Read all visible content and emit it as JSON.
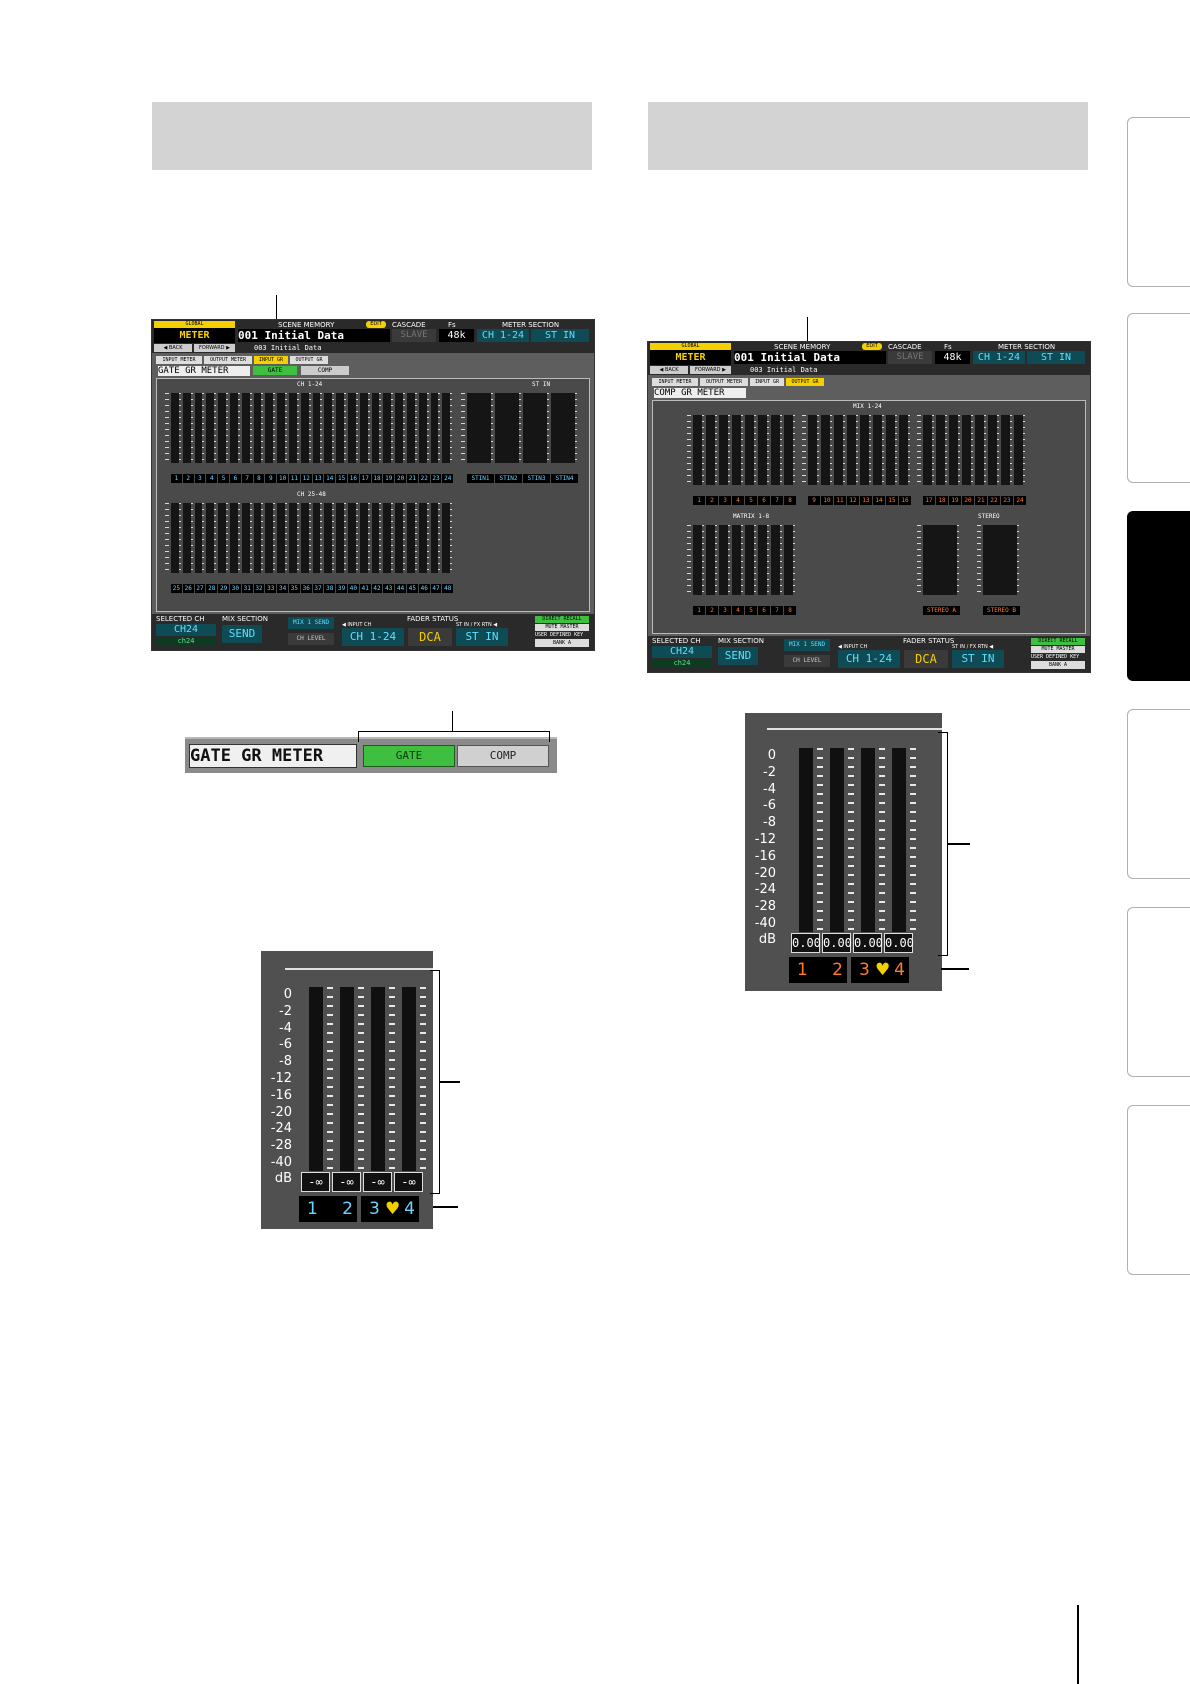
{
  "left_shot": {
    "global": "GLOBAL",
    "mode": "METER",
    "back": "◀ BACK",
    "forward": "FORWARD ▶",
    "scene_memory_label": "SCENE MEMORY",
    "edit_badge": "EDIT",
    "scene_name": "001 Initial Data",
    "last_scene": "003 Initial Data",
    "cascade_label": "CASCADE",
    "slave": "SLAVE",
    "fs_label": "Fs",
    "fs_value": "48k",
    "meter_section_label": "METER SECTION",
    "meter_ch": "CH 1-24",
    "meter_st": "ST IN",
    "tabs": [
      "INPUT METER",
      "OUTPUT METER",
      "INPUT GR",
      "OUTPUT GR"
    ],
    "page_title": "GATE GR METER",
    "gate_btn": "GATE",
    "comp_btn": "COMP",
    "group1_title": "CH 1-24",
    "group2_title": "ST IN",
    "group3_title": "CH 25-48",
    "ch_labels_row1": [
      "1",
      "2",
      "3",
      "4",
      "5",
      "6",
      "7",
      "8",
      "9",
      "10",
      "11",
      "12",
      "13",
      "14",
      "15",
      "16",
      "17",
      "18",
      "19",
      "20",
      "21",
      "22",
      "23",
      "24"
    ],
    "st_labels": [
      "STIN1",
      "STIN2",
      "STIN3",
      "STIN4"
    ],
    "ch_labels_row2": [
      "25",
      "26",
      "27",
      "28",
      "29",
      "30",
      "31",
      "32",
      "33",
      "34",
      "35",
      "36",
      "37",
      "38",
      "39",
      "40",
      "41",
      "42",
      "43",
      "44",
      "45",
      "46",
      "47",
      "48"
    ],
    "selected_ch_label": "SELECTED CH",
    "selected_ch": "CH24",
    "selected_ch_name": "ch24",
    "mix_section_label": "MIX SECTION",
    "mix_send": "SEND",
    "mix1_send": "MIX 1 SEND",
    "ch_level": "CH LEVEL",
    "fader_status_label": "FADER STATUS",
    "input_ch_label": "◀ INPUT CH",
    "fader_ch": "CH 1-24",
    "dca": "DCA",
    "stin_label": "ST IN / FX RTN ◀",
    "fader_stin": "ST IN",
    "direct_recall": "DIRECT RECALL",
    "mute_master": "MUTE MASTER",
    "user_key": "USER DEFINED KEY",
    "bank": "BANK A"
  },
  "right_shot": {
    "global": "GLOBAL",
    "mode": "METER",
    "back": "◀ BACK",
    "forward": "FORWARD ▶",
    "scene_memory_label": "SCENE MEMORY",
    "edit_badge": "EDIT",
    "scene_name": "001 Initial Data",
    "last_scene": "003 Initial Data",
    "cascade_label": "CASCADE",
    "slave": "SLAVE",
    "fs_label": "Fs",
    "fs_value": "48k",
    "meter_section_label": "METER SECTION",
    "meter_ch": "CH 1-24",
    "meter_st": "ST IN",
    "tabs": [
      "INPUT METER",
      "OUTPUT METER",
      "INPUT GR",
      "OUTPUT GR"
    ],
    "page_title": "COMP GR METER",
    "group1_title": "MIX 1-24",
    "group2_title": "MATRIX 1-8",
    "group3_title": "STEREO",
    "mix_labels": [
      "1",
      "2",
      "3",
      "4",
      "5",
      "6",
      "7",
      "8",
      "9",
      "10",
      "11",
      "12",
      "13",
      "14",
      "15",
      "16",
      "17",
      "18",
      "19",
      "20",
      "21",
      "22",
      "23",
      "24"
    ],
    "matrix_labels": [
      "1",
      "2",
      "3",
      "4",
      "5",
      "6",
      "7",
      "8"
    ],
    "stereo_labels": [
      "STEREO A",
      "STEREO B"
    ],
    "selected_ch_label": "SELECTED CH",
    "selected_ch": "CH24",
    "selected_ch_name": "ch24",
    "mix_section_label": "MIX SECTION",
    "mix_send": "SEND",
    "mix1_send": "MIX 1 SEND",
    "ch_level": "CH LEVEL",
    "fader_status_label": "FADER STATUS",
    "input_ch_label": "◀ INPUT CH",
    "fader_ch": "CH 1-24",
    "dca": "DCA",
    "stin_label": "ST IN / FX RTN ◀",
    "fader_stin": "ST IN",
    "direct_recall": "DIRECT RECALL",
    "mute_master": "MUTE MASTER",
    "user_key": "USER DEFINED KEY",
    "bank": "BANK A"
  },
  "gate_strip": {
    "title": "GATE GR METER",
    "gate_btn": "GATE",
    "comp_btn": "COMP"
  },
  "zoom_scale": [
    "0",
    "-2",
    "-4",
    "-6",
    "-8",
    "-12",
    "-16",
    "-20",
    "-24",
    "-28",
    "-40"
  ],
  "zoom_db": "dB",
  "zoom_left": {
    "values": [
      "-∞",
      "-∞",
      "-∞",
      "-∞"
    ],
    "channels": [
      "1",
      "2",
      "3",
      "4"
    ],
    "heart": "♥"
  },
  "zoom_right": {
    "values": [
      "0.00",
      "0.00",
      "0.00",
      "0.00"
    ],
    "channels": [
      "1",
      "2",
      "3",
      "4"
    ],
    "heart": "♥"
  },
  "colors": {
    "header_gray": "#d3d3d3",
    "gate_green": "#3fbf3f",
    "input_blue": "#6fd3ff",
    "output_orange": "#ff7a2a",
    "heart_yellow": "#f4d000"
  }
}
